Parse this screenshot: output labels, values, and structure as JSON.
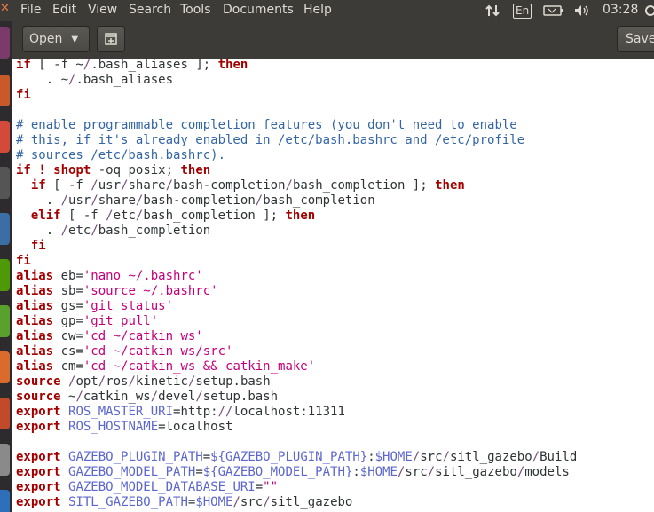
{
  "menubar": {
    "items": [
      "File",
      "Edit",
      "View",
      "Search",
      "Tools",
      "Documents",
      "Help"
    ],
    "lang": "En",
    "clock": "03:28"
  },
  "header": {
    "open_label": "Open",
    "save_label": "Save"
  },
  "lines": [
    [
      [
        "kw",
        "if"
      ],
      [
        "t",
        " [ -f ~"
      ],
      [
        "pt",
        "/"
      ],
      [
        "t",
        ".bash_aliases ]; "
      ],
      [
        "kw",
        "then"
      ]
    ],
    [
      [
        "t",
        "    . ~"
      ],
      [
        "pt",
        "/"
      ],
      [
        "t",
        ".bash_aliases"
      ]
    ],
    [
      [
        "kw",
        "fi"
      ]
    ],
    [
      [
        "t",
        ""
      ]
    ],
    [
      [
        "cm",
        "# enable programmable completion features (you don't need to enable"
      ]
    ],
    [
      [
        "cm",
        "# this, if it's already enabled in /etc/bash.bashrc and /etc/profile"
      ]
    ],
    [
      [
        "cm",
        "# sources /etc/bash.bashrc)."
      ]
    ],
    [
      [
        "kw",
        "if"
      ],
      [
        "t",
        " "
      ],
      [
        "kw",
        "!"
      ],
      [
        "t",
        " "
      ],
      [
        "kw",
        "shopt"
      ],
      [
        "t",
        " -oq posix; "
      ],
      [
        "kw",
        "then"
      ]
    ],
    [
      [
        "t",
        "  "
      ],
      [
        "kw",
        "if"
      ],
      [
        "t",
        " [ -f "
      ],
      [
        "pt",
        "/"
      ],
      [
        "t",
        "usr"
      ],
      [
        "pt",
        "/"
      ],
      [
        "t",
        "share"
      ],
      [
        "pt",
        "/"
      ],
      [
        "t",
        "bash-completion"
      ],
      [
        "pt",
        "/"
      ],
      [
        "t",
        "bash_completion ]; "
      ],
      [
        "kw",
        "then"
      ]
    ],
    [
      [
        "t",
        "    . "
      ],
      [
        "pt",
        "/"
      ],
      [
        "t",
        "usr"
      ],
      [
        "pt",
        "/"
      ],
      [
        "t",
        "share"
      ],
      [
        "pt",
        "/"
      ],
      [
        "t",
        "bash-completion"
      ],
      [
        "pt",
        "/"
      ],
      [
        "t",
        "bash_completion"
      ]
    ],
    [
      [
        "t",
        "  "
      ],
      [
        "kw",
        "elif"
      ],
      [
        "t",
        " [ -f "
      ],
      [
        "pt",
        "/"
      ],
      [
        "t",
        "etc"
      ],
      [
        "pt",
        "/"
      ],
      [
        "t",
        "bash_completion ]; "
      ],
      [
        "kw",
        "then"
      ]
    ],
    [
      [
        "t",
        "    . "
      ],
      [
        "pt",
        "/"
      ],
      [
        "t",
        "etc"
      ],
      [
        "pt",
        "/"
      ],
      [
        "t",
        "bash_completion"
      ]
    ],
    [
      [
        "t",
        "  "
      ],
      [
        "kw",
        "fi"
      ]
    ],
    [
      [
        "kw",
        "fi"
      ]
    ],
    [
      [
        "kw",
        "alias"
      ],
      [
        "t",
        " eb="
      ],
      [
        "st",
        "'nano ~/.bashrc'"
      ]
    ],
    [
      [
        "kw",
        "alias"
      ],
      [
        "t",
        " sb="
      ],
      [
        "st",
        "'source ~/.bashrc'"
      ]
    ],
    [
      [
        "kw",
        "alias"
      ],
      [
        "t",
        " gs="
      ],
      [
        "st",
        "'git status'"
      ]
    ],
    [
      [
        "kw",
        "alias"
      ],
      [
        "t",
        " gp="
      ],
      [
        "st",
        "'git pull'"
      ]
    ],
    [
      [
        "kw",
        "alias"
      ],
      [
        "t",
        " cw="
      ],
      [
        "st",
        "'cd ~/catkin_ws'"
      ]
    ],
    [
      [
        "kw",
        "alias"
      ],
      [
        "t",
        " cs="
      ],
      [
        "st",
        "'cd ~/catkin_ws/src'"
      ]
    ],
    [
      [
        "kw",
        "alias"
      ],
      [
        "t",
        " cm="
      ],
      [
        "st",
        "'cd ~/catkin_ws && catkin_make'"
      ]
    ],
    [
      [
        "kw",
        "source"
      ],
      [
        "t",
        " "
      ],
      [
        "pt",
        "/"
      ],
      [
        "t",
        "opt"
      ],
      [
        "pt",
        "/"
      ],
      [
        "t",
        "ros"
      ],
      [
        "pt",
        "/"
      ],
      [
        "t",
        "kinetic"
      ],
      [
        "pt",
        "/"
      ],
      [
        "t",
        "setup.bash"
      ]
    ],
    [
      [
        "kw",
        "source"
      ],
      [
        "t",
        " ~"
      ],
      [
        "pt",
        "/"
      ],
      [
        "t",
        "catkin_ws"
      ],
      [
        "pt",
        "/"
      ],
      [
        "t",
        "devel"
      ],
      [
        "pt",
        "/"
      ],
      [
        "t",
        "setup.bash"
      ]
    ],
    [
      [
        "kw",
        "export"
      ],
      [
        "t",
        " "
      ],
      [
        "vr",
        "ROS_MASTER_URI"
      ],
      [
        "t",
        "=http:"
      ],
      [
        "pt",
        "//"
      ],
      [
        "t",
        "localhost:11311"
      ]
    ],
    [
      [
        "kw",
        "export"
      ],
      [
        "t",
        " "
      ],
      [
        "vr",
        "ROS_HOSTNAME"
      ],
      [
        "t",
        "=localhost"
      ]
    ],
    [
      [
        "t",
        ""
      ]
    ],
    [
      [
        "kw",
        "export"
      ],
      [
        "t",
        " "
      ],
      [
        "vr",
        "GAZEBO_PLUGIN_PATH"
      ],
      [
        "t",
        "="
      ],
      [
        "vr",
        "${GAZEBO_PLUGIN_PATH}"
      ],
      [
        "t",
        ":"
      ],
      [
        "vr",
        "$HOME"
      ],
      [
        "pt",
        "/"
      ],
      [
        "t",
        "src"
      ],
      [
        "pt",
        "/"
      ],
      [
        "t",
        "sitl_gazebo"
      ],
      [
        "pt",
        "/"
      ],
      [
        "t",
        "Build"
      ]
    ],
    [
      [
        "kw",
        "export"
      ],
      [
        "t",
        " "
      ],
      [
        "vr",
        "GAZEBO_MODEL_PATH"
      ],
      [
        "t",
        "="
      ],
      [
        "vr",
        "${GAZEBO_MODEL_PATH}"
      ],
      [
        "t",
        ":"
      ],
      [
        "vr",
        "$HOME"
      ],
      [
        "pt",
        "/"
      ],
      [
        "t",
        "src"
      ],
      [
        "pt",
        "/"
      ],
      [
        "t",
        "sitl_gazebo"
      ],
      [
        "pt",
        "/"
      ],
      [
        "t",
        "models"
      ]
    ],
    [
      [
        "kw",
        "export"
      ],
      [
        "t",
        " "
      ],
      [
        "vr",
        "GAZEBO_MODEL_DATABASE_URI"
      ],
      [
        "t",
        "="
      ],
      [
        "st",
        "\"\""
      ]
    ],
    [
      [
        "kw",
        "export"
      ],
      [
        "t",
        " "
      ],
      [
        "vr",
        "SITL_GAZEBO_PATH"
      ],
      [
        "t",
        "="
      ],
      [
        "vr",
        "$HOME"
      ],
      [
        "pt",
        "/"
      ],
      [
        "t",
        "src"
      ],
      [
        "pt",
        "/"
      ],
      [
        "t",
        "sitl_gazebo"
      ]
    ]
  ]
}
